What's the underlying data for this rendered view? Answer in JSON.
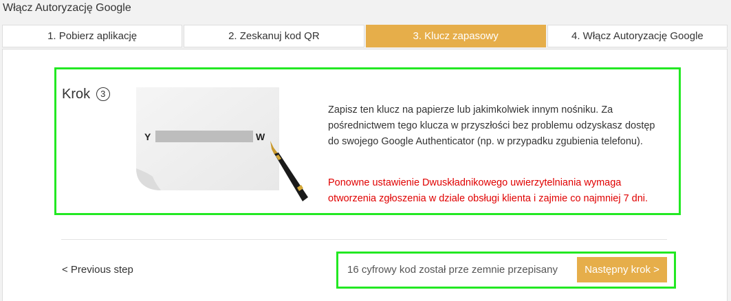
{
  "page": {
    "title": "Włącz Autoryzację Google"
  },
  "tabs": [
    {
      "label": "1. Pobierz aplikację",
      "active": false
    },
    {
      "label": "2. Zeskanuj kod QR",
      "active": false
    },
    {
      "label": "3. Klucz zapasowy",
      "active": true
    },
    {
      "label": "4. Włącz Autoryzację Google",
      "active": false
    }
  ],
  "step": {
    "heading": "Krok",
    "number": "3",
    "illustration": {
      "left_letter": "Y",
      "right_letter": "W"
    },
    "description": "Zapisz ten klucz na papierze lub jakimkolwiek innym nośniku. Za pośrednictwem tego klucza w przyszłości bez problemu odzyskasz dostęp do swojego Google Authenticator (np. w przypadku zgubienia telefonu).",
    "warning": "Ponowne ustawienie Dwuskładnikowego uwierzytelniania wymaga otworzenia zgłoszenia w dziale obsługi klienta i zajmie co najmniej 7 dni."
  },
  "footer": {
    "previous_label": "< Previous step",
    "confirm_text": "16 cyfrowy kod został prze zemnie przepisany",
    "next_label": "Następny krok >"
  },
  "colors": {
    "accent": "#e6ae4a",
    "warning": "#e00000",
    "highlight": "#22e822"
  }
}
